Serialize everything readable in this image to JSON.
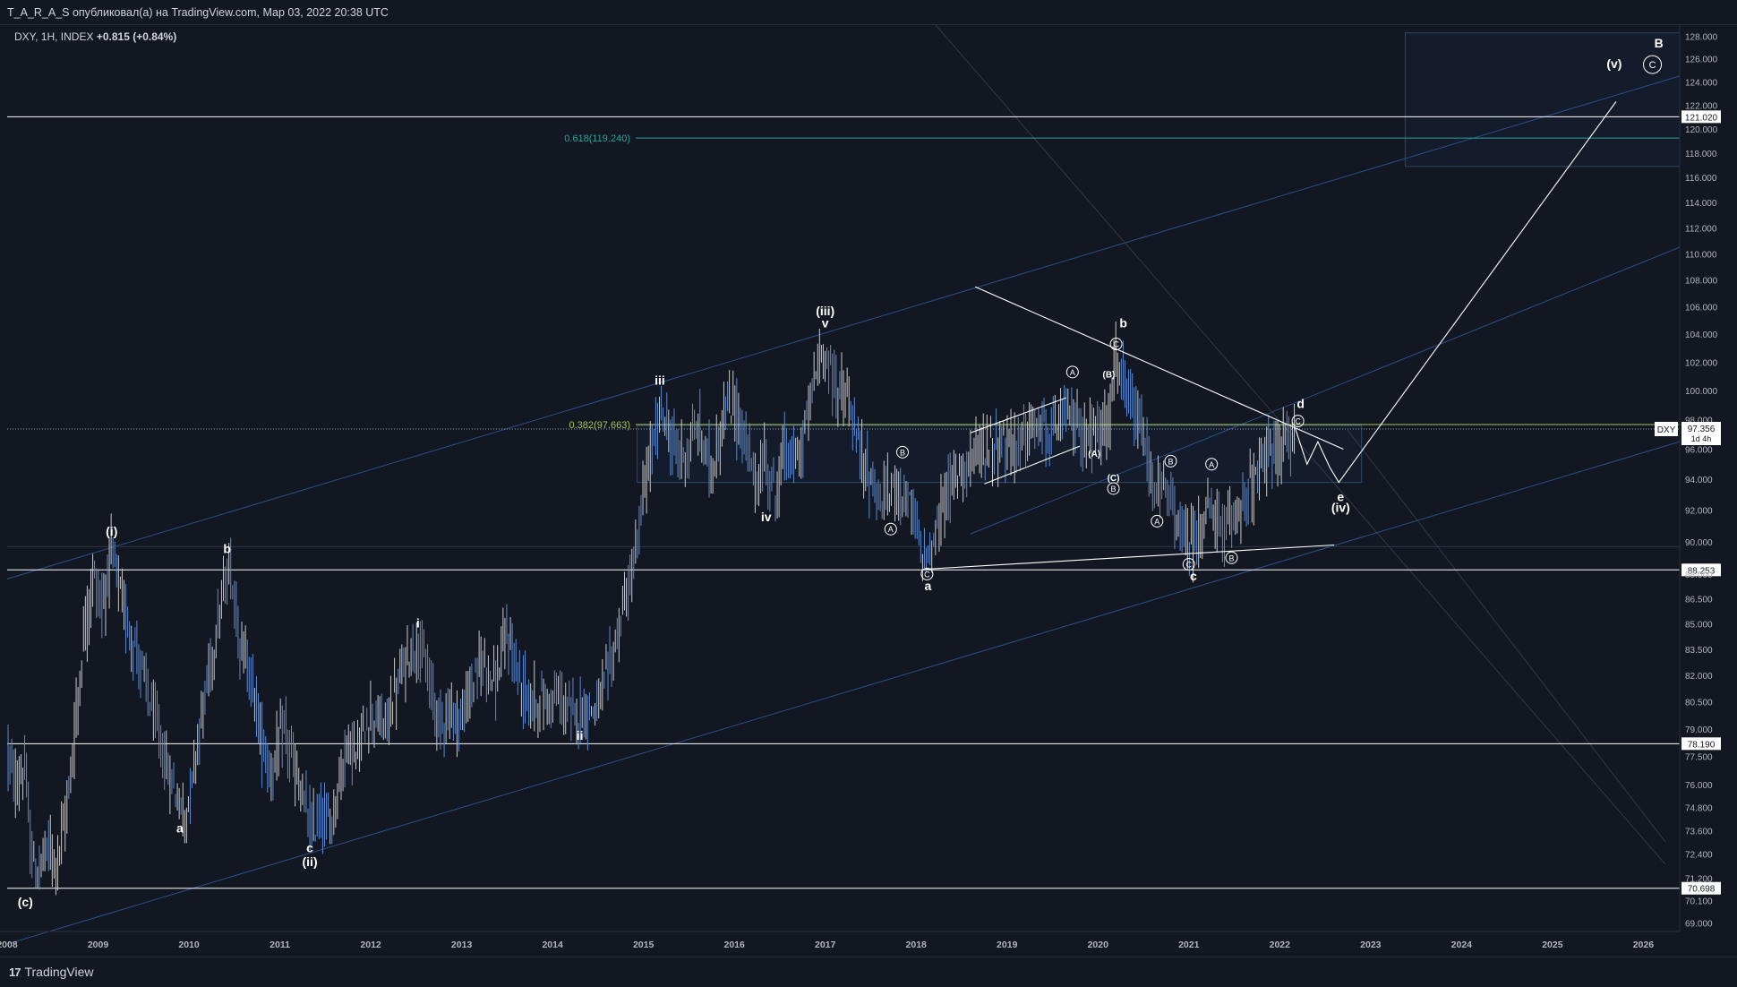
{
  "header": {
    "publisher_line": "T_A_R_A_S опубликовал(а) на TradingView.com, Мар 03, 2022 20:38 UTC"
  },
  "legend": {
    "symbol": "DXY, 1H, INDEX",
    "change": "+0.815 (+0.84%)"
  },
  "footer": {
    "logo_mark": "17",
    "logo_text": "TradingView"
  },
  "colors": {
    "background": "#131722",
    "candle": "#5b8ad0",
    "candle_alt": "#c8c8c8",
    "fib_382": "#a8c64e",
    "fib_618": "#26a69a",
    "line": "#ffffff",
    "channel": "#2a4f8a"
  },
  "price_tag": {
    "symbol": "DXY",
    "price": "97.356",
    "countdown": "1d 4h"
  },
  "chart_data": {
    "type": "candlestick",
    "x_range": [
      2008.0,
      2026.4
    ],
    "y_scale": "log",
    "y_range": [
      68.6,
      129.0
    ],
    "x_ticks": [
      "2008",
      "2009",
      "2010",
      "2011",
      "2012",
      "2013",
      "2014",
      "2015",
      "2016",
      "2017",
      "2018",
      "2019",
      "2020",
      "2021",
      "2022",
      "2023",
      "2024",
      "2025",
      "2026"
    ],
    "y_ticks": [
      "128.000",
      "126.000",
      "124.000",
      "122.000",
      "120.000",
      "118.000",
      "116.000",
      "114.000",
      "112.000",
      "110.000",
      "108.000",
      "106.000",
      "104.000",
      "102.000",
      "100.000",
      "98.000",
      "96.000",
      "94.000",
      "92.000",
      "90.000",
      "88.000",
      "86.500",
      "85.000",
      "83.500",
      "82.000",
      "80.500",
      "79.000",
      "77.500",
      "76.000",
      "74.800",
      "73.600",
      "72.400",
      "71.200",
      "70.100",
      "69.000"
    ],
    "horizontal_levels": [
      {
        "label": "121.020",
        "price": 121.02
      },
      {
        "label": "88.253",
        "price": 88.253
      },
      {
        "label": "78.190",
        "price": 78.19
      },
      {
        "label": "70.698",
        "price": 70.698
      }
    ],
    "fib_levels": [
      {
        "label": "0.382(97.663)",
        "price": 97.663
      },
      {
        "label": "0.618(119.240)",
        "price": 119.24
      }
    ],
    "price_path": [
      [
        2008.0,
        78.0
      ],
      [
        2008.08,
        76.0
      ],
      [
        2008.2,
        76.8
      ],
      [
        2008.25,
        73.0
      ],
      [
        2008.32,
        71.3
      ],
      [
        2008.45,
        72.8
      ],
      [
        2008.55,
        72.0
      ],
      [
        2008.65,
        74.5
      ],
      [
        2008.75,
        79.0
      ],
      [
        2008.85,
        84.5
      ],
      [
        2008.95,
        88.0
      ],
      [
        2009.05,
        86.0
      ],
      [
        2009.15,
        89.5
      ],
      [
        2009.3,
        85.5
      ],
      [
        2009.45,
        83.0
      ],
      [
        2009.6,
        80.0
      ],
      [
        2009.75,
        77.0
      ],
      [
        2009.9,
        75.0
      ],
      [
        2009.97,
        74.3
      ],
      [
        2010.1,
        78.5
      ],
      [
        2010.25,
        83.0
      ],
      [
        2010.35,
        86.0
      ],
      [
        2010.45,
        88.5
      ],
      [
        2010.55,
        84.5
      ],
      [
        2010.7,
        81.5
      ],
      [
        2010.8,
        78.5
      ],
      [
        2010.9,
        76.5
      ],
      [
        2011.05,
        79.0
      ],
      [
        2011.15,
        77.0
      ],
      [
        2011.3,
        74.5
      ],
      [
        2011.35,
        73.4
      ],
      [
        2011.45,
        74.5
      ],
      [
        2011.55,
        73.8
      ],
      [
        2011.65,
        76.0
      ],
      [
        2011.75,
        78.5
      ],
      [
        2011.85,
        77.5
      ],
      [
        2012.0,
        80.0
      ],
      [
        2012.15,
        79.0
      ],
      [
        2012.3,
        81.5
      ],
      [
        2012.4,
        83.0
      ],
      [
        2012.52,
        84.0
      ],
      [
        2012.65,
        81.5
      ],
      [
        2012.75,
        79.5
      ],
      [
        2012.85,
        80.0
      ],
      [
        2013.0,
        79.5
      ],
      [
        2013.15,
        82.0
      ],
      [
        2013.25,
        83.0
      ],
      [
        2013.38,
        81.5
      ],
      [
        2013.5,
        84.5
      ],
      [
        2013.62,
        82.0
      ],
      [
        2013.75,
        80.5
      ],
      [
        2013.9,
        80.5
      ],
      [
        2014.05,
        80.8
      ],
      [
        2014.2,
        79.8
      ],
      [
        2014.35,
        80.0
      ],
      [
        2014.5,
        80.2
      ],
      [
        2014.6,
        82.0
      ],
      [
        2014.7,
        84.0
      ],
      [
        2014.8,
        86.5
      ],
      [
        2014.9,
        88.5
      ],
      [
        2015.0,
        93.0
      ],
      [
        2015.1,
        96.0
      ],
      [
        2015.2,
        99.0
      ],
      [
        2015.3,
        96.5
      ],
      [
        2015.45,
        95.5
      ],
      [
        2015.6,
        97.5
      ],
      [
        2015.75,
        94.5
      ],
      [
        2015.9,
        98.5
      ],
      [
        2016.0,
        99.0
      ],
      [
        2016.1,
        97.0
      ],
      [
        2016.25,
        93.5
      ],
      [
        2016.35,
        95.5
      ],
      [
        2016.45,
        92.8
      ],
      [
        2016.55,
        96.0
      ],
      [
        2016.7,
        95.0
      ],
      [
        2016.8,
        98.0
      ],
      [
        2016.9,
        101.5
      ],
      [
        2017.0,
        103.0
      ],
      [
        2017.1,
        100.5
      ],
      [
        2017.25,
        99.5
      ],
      [
        2017.35,
        96.5
      ],
      [
        2017.5,
        94.0
      ],
      [
        2017.62,
        92.5
      ],
      [
        2017.75,
        93.5
      ],
      [
        2017.85,
        93.5
      ],
      [
        2017.95,
        92.0
      ],
      [
        2018.08,
        89.0
      ],
      [
        2018.2,
        89.8
      ],
      [
        2018.3,
        92.5
      ],
      [
        2018.45,
        94.5
      ],
      [
        2018.6,
        95.5
      ],
      [
        2018.75,
        96.0
      ],
      [
        2018.9,
        96.5
      ],
      [
        2019.05,
        96.0
      ],
      [
        2019.2,
        97.0
      ],
      [
        2019.35,
        97.5
      ],
      [
        2019.5,
        97.0
      ],
      [
        2019.65,
        98.5
      ],
      [
        2019.8,
        97.5
      ],
      [
        2019.9,
        96.8
      ],
      [
        2020.05,
        97.5
      ],
      [
        2020.15,
        99.0
      ],
      [
        2020.2,
        102.5
      ],
      [
        2020.3,
        99.5
      ],
      [
        2020.4,
        98.5
      ],
      [
        2020.5,
        96.5
      ],
      [
        2020.6,
        93.5
      ],
      [
        2020.7,
        93.5
      ],
      [
        2020.8,
        92.5
      ],
      [
        2020.9,
        91.0
      ],
      [
        2021.0,
        89.8
      ],
      [
        2021.1,
        90.5
      ],
      [
        2021.2,
        92.0
      ],
      [
        2021.3,
        91.5
      ],
      [
        2021.4,
        90.2
      ],
      [
        2021.5,
        92.0
      ],
      [
        2021.6,
        92.8
      ],
      [
        2021.7,
        93.5
      ],
      [
        2021.8,
        94.5
      ],
      [
        2021.9,
        96.0
      ],
      [
        2022.0,
        95.8
      ],
      [
        2022.1,
        96.5
      ],
      [
        2022.17,
        97.4
      ]
    ],
    "wave_labels": [
      {
        "text": "(c)",
        "x": 2008.2,
        "y": 69.8
      },
      {
        "text": "(i)",
        "x": 2009.15,
        "y": 90.4
      },
      {
        "text": "a",
        "x": 2009.9,
        "y": 73.5
      },
      {
        "text": "b",
        "x": 2010.42,
        "y": 89.3
      },
      {
        "text": "c",
        "x": 2011.33,
        "y": 72.5
      },
      {
        "text": "(ii)",
        "x": 2011.33,
        "y": 71.8
      },
      {
        "text": "i",
        "x": 2012.52,
        "y": 84.8
      },
      {
        "text": "ii",
        "x": 2014.3,
        "y": 78.4
      },
      {
        "text": "iii",
        "x": 2015.18,
        "y": 100.4
      },
      {
        "text": "iv",
        "x": 2016.35,
        "y": 91.3
      },
      {
        "text": "(iii)",
        "x": 2017.0,
        "y": 105.4
      },
      {
        "text": "v",
        "x": 2017.0,
        "y": 104.5
      },
      {
        "text": "a",
        "x": 2018.13,
        "y": 87.0
      },
      {
        "text": "b",
        "x": 2020.28,
        "y": 104.5
      },
      {
        "text": "c",
        "x": 2021.05,
        "y": 87.6
      },
      {
        "text": "d",
        "x": 2022.23,
        "y": 98.8
      },
      {
        "text": "e",
        "x": 2022.67,
        "y": 92.6
      },
      {
        "text": "(iv)",
        "x": 2022.67,
        "y": 91.9
      },
      {
        "text": "(v)",
        "x": 2025.68,
        "y": 125.2
      },
      {
        "text": "B",
        "x": 2026.17,
        "y": 127.0
      }
    ],
    "circle_labels": [
      {
        "text": "A",
        "x": 2017.72,
        "y": 90.8
      },
      {
        "text": "B",
        "x": 2017.85,
        "y": 95.8
      },
      {
        "text": "C",
        "x": 2018.12,
        "y": 88.0
      },
      {
        "text": "A",
        "x": 2019.72,
        "y": 101.3
      },
      {
        "text": "C",
        "x": 2020.2,
        "y": 103.3
      },
      {
        "text": "A",
        "x": 2020.65,
        "y": 91.3
      },
      {
        "text": "B",
        "x": 2020.8,
        "y": 95.2
      },
      {
        "text": "A",
        "x": 2021.25,
        "y": 95.0
      },
      {
        "text": "C",
        "x": 2021.0,
        "y": 88.6
      },
      {
        "text": "B",
        "x": 2021.47,
        "y": 89.0
      },
      {
        "text": "C",
        "x": 2022.2,
        "y": 97.9
      },
      {
        "text": "C",
        "x": 2026.1,
        "y": 125.5
      },
      {
        "text": "B",
        "x": 2020.17,
        "y": 93.4
      }
    ],
    "small_labels": [
      {
        "text": "(B)",
        "x": 2020.12,
        "y": 100.9
      },
      {
        "text": "(A)",
        "x": 2019.96,
        "y": 95.5
      },
      {
        "text": "(C)",
        "x": 2020.17,
        "y": 93.9
      }
    ]
  }
}
